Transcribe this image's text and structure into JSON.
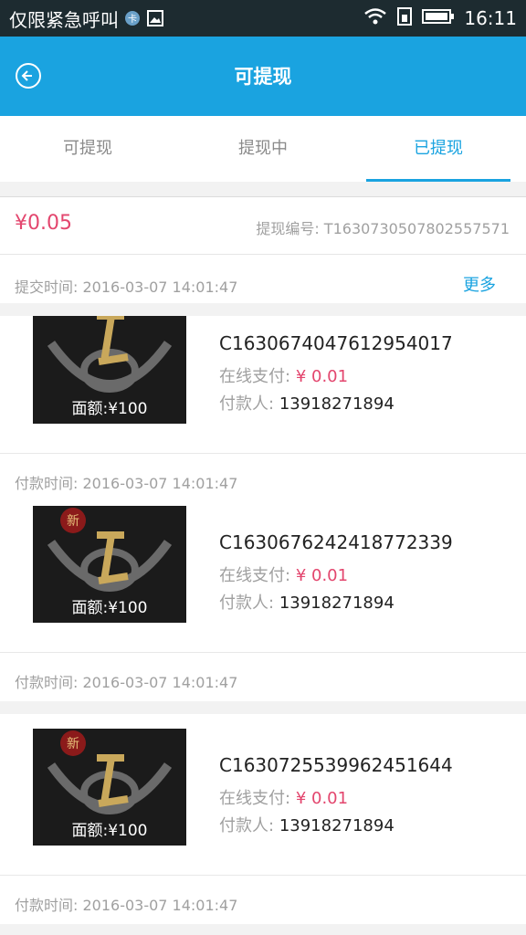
{
  "status_bar": {
    "carrier": "仅限紧急呼叫",
    "time": "16:11"
  },
  "header": {
    "title": "可提现"
  },
  "tabs": [
    {
      "label": "可提现",
      "active": false
    },
    {
      "label": "提现中",
      "active": false
    },
    {
      "label": "已提现",
      "active": true
    }
  ],
  "withdrawal": {
    "amount": "¥0.05",
    "order_no": "提现编号: T1630730507802557571",
    "submit_time": "提交时间: 2016-03-07 14:01:47",
    "more_label": "更多"
  },
  "items": [
    {
      "code": "C1630674047612954017",
      "pay_label": "在线支付:",
      "pay_value": "¥ 0.01",
      "payer_label": "付款人:",
      "payer_value": "13918271894",
      "face_label": "面额:¥100",
      "pay_time": "付款时间: 2016-03-07 14:01:47"
    },
    {
      "code": "C1630676242418772339",
      "pay_label": "在线支付:",
      "pay_value": "¥ 0.01",
      "payer_label": "付款人:",
      "payer_value": "13918271894",
      "face_label": "面额:¥100",
      "pay_time": "付款时间: 2016-03-07 14:01:47"
    },
    {
      "code": "C1630725539962451644",
      "pay_label": "在线支付:",
      "pay_value": "¥ 0.01",
      "payer_label": "付款人:",
      "payer_value": "13918271894",
      "face_label": "面额:¥100",
      "pay_time": "付款时间: 2016-03-07 14:01:47"
    }
  ],
  "colors": {
    "accent": "#1aa3e0",
    "price": "#e3466e"
  }
}
